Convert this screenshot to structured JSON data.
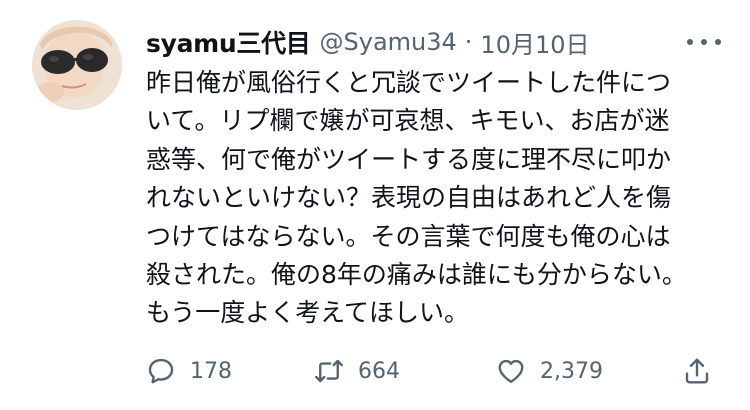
{
  "tweet": {
    "author_name": "syamu三代目",
    "handle": "@Syamu34",
    "separator": "·",
    "date": "10月10日",
    "text_lines": [
      "昨日俺が風俗行くと冗談でツイートした件につ",
      "いて。リプ欄で嬢が可哀想、キモい、お店が迷",
      "惑等、何で俺がツイートする度に理不尽に叩か",
      "れないといけない？表現の自由はあれど人を傷",
      "つけてはならない。その言葉で何度も俺の心は",
      "殺された。俺の8年の痛みは誰にも分からない。",
      "もう一度よく考えてほしい。"
    ]
  },
  "actions": {
    "reply_count": "178",
    "retweet_count": "664",
    "like_count": "2,379"
  },
  "icons": {
    "more": "more-horizontal-icon",
    "reply": "comment-icon",
    "retweet": "retweet-icon",
    "like": "heart-icon",
    "share": "share-icon"
  },
  "colors": {
    "text": "#0f1419",
    "secondary": "#536471",
    "background": "#ffffff"
  }
}
